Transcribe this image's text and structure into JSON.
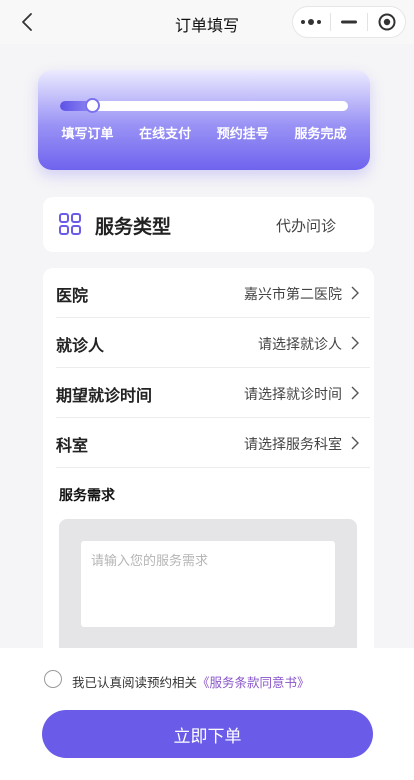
{
  "nav": {
    "title": "订单填写"
  },
  "progress": {
    "steps": [
      "填写订单",
      "在线支付",
      "预约挂号",
      "服务完成"
    ],
    "current_step": 1,
    "fraction": 0.11
  },
  "service_type": {
    "title": "服务类型",
    "value": "代办问诊"
  },
  "form": {
    "rows": [
      {
        "label": "医院",
        "value": "嘉兴市第二医院"
      },
      {
        "label": "就诊人",
        "value": "请选择就诊人"
      },
      {
        "label": "期望就诊时间",
        "value": "请选择就诊时间"
      },
      {
        "label": "科室",
        "value": "请选择服务科室"
      }
    ],
    "needs_title": "服务需求",
    "needs_placeholder": "请输入您的服务需求"
  },
  "agreement": {
    "text": "我已认真阅读预约相关",
    "link": "《服务条款同意书》",
    "checked": false
  },
  "submit": {
    "label": "立即下单"
  },
  "colors": {
    "accent": "#6a5ce9",
    "link": "#8a55c9"
  }
}
